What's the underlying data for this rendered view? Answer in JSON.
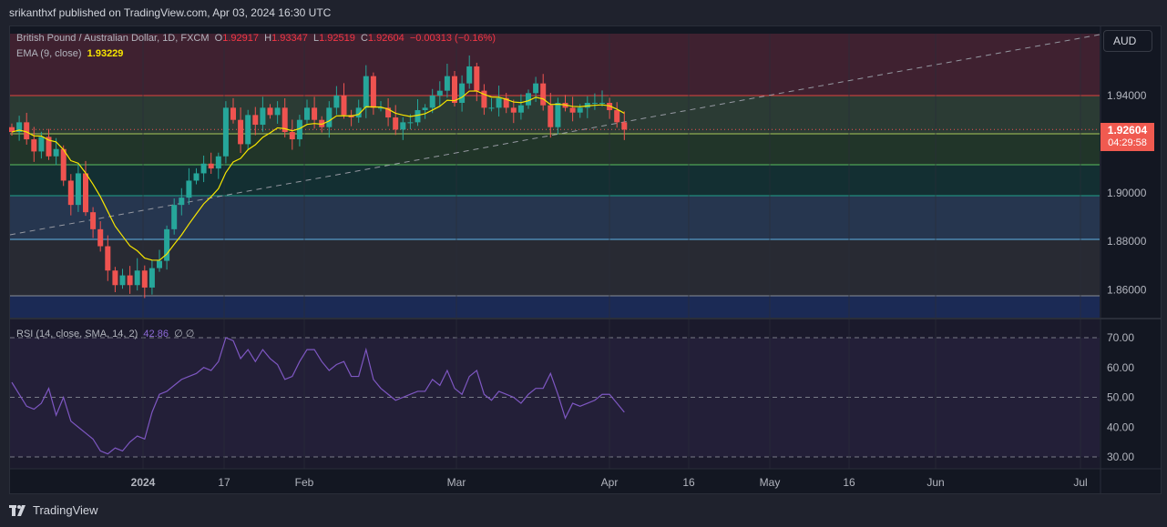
{
  "header": {
    "publisher_line": "srikanthxf published on TradingView.com, Apr 03, 2024 16:30 UTC"
  },
  "legend": {
    "symbol": "British Pound / Australian Dollar, 1D, FXCM",
    "o_label": "O",
    "o": "1.92917",
    "h_label": "H",
    "h": "1.93347",
    "l_label": "L",
    "l": "1.92519",
    "c_label": "C",
    "c": "1.92604",
    "change": "−0.00313 (−0.16%)",
    "ema_label": "EMA (9, close)",
    "ema_value": "1.93229",
    "rsi_label": "RSI (14, close, SMA, 14, 2)",
    "rsi_value": "42.86",
    "rsi_extra": "∅ ∅"
  },
  "price_axis": {
    "currency": "AUD",
    "last_price": "1.92604",
    "countdown": "04:29:58",
    "ticks": [
      "1.94000",
      "1.90000",
      "1.88000",
      "1.86000"
    ]
  },
  "rsi_axis": {
    "ticks": [
      "70.00",
      "60.00",
      "50.00",
      "40.00",
      "30.00"
    ]
  },
  "time_axis": {
    "labels": [
      "2024",
      "17",
      "Feb",
      "Mar",
      "Apr",
      "16",
      "May",
      "16",
      "Jun",
      "Jul"
    ]
  },
  "footer": {
    "brand": "TradingView"
  },
  "colors": {
    "up": "#26a69a",
    "down": "#ef5350",
    "ema": "#f7e600",
    "rsi": "#7e57c2"
  },
  "chart_data": {
    "type": "candlestick",
    "symbol": "GBPAUD",
    "timeframe": "1D",
    "ylim": [
      1.85,
      1.965
    ],
    "closes": [
      1.925,
      1.929,
      1.922,
      1.917,
      1.923,
      1.915,
      1.918,
      1.905,
      1.895,
      1.908,
      1.892,
      1.885,
      1.878,
      1.868,
      1.862,
      1.866,
      1.862,
      1.868,
      1.861,
      1.869,
      1.872,
      1.885,
      1.895,
      1.898,
      1.905,
      1.908,
      1.912,
      1.91,
      1.915,
      1.935,
      1.93,
      1.92,
      1.932,
      1.928,
      1.935,
      1.932,
      1.935,
      1.925,
      1.922,
      1.93,
      1.935,
      1.93,
      1.927,
      1.935,
      1.94,
      1.932,
      1.931,
      1.935,
      1.948,
      1.935,
      1.935,
      1.931,
      1.926,
      1.929,
      1.929,
      1.934,
      1.935,
      1.94,
      1.942,
      1.948,
      1.937,
      1.945,
      1.952,
      1.942,
      1.935,
      1.935,
      1.939,
      1.935,
      1.933,
      1.936,
      1.941,
      1.945,
      1.936,
      1.927,
      1.937,
      1.935,
      1.933,
      1.935,
      1.937,
      1.937,
      1.937,
      1.934,
      1.929,
      1.926
    ],
    "levels": [
      1.94,
      1.9275,
      1.915,
      1.9025,
      1.8845,
      1.8615
    ],
    "rsi": {
      "ylim": [
        25,
        75
      ],
      "levels": [
        70,
        50,
        30
      ],
      "values": [
        55,
        51,
        47,
        46,
        48,
        53,
        44,
        50,
        42,
        40,
        38,
        36,
        32,
        31,
        33,
        32,
        35,
        37,
        36,
        45,
        51,
        52,
        54,
        56,
        57,
        58,
        60,
        59,
        62,
        70,
        69,
        63,
        66,
        62,
        66,
        63,
        61,
        56,
        57,
        62,
        66,
        66,
        62,
        59,
        61,
        62,
        57,
        57,
        66,
        56,
        53,
        51,
        49,
        50,
        51,
        52,
        52,
        56,
        54,
        59,
        53,
        51,
        57,
        59,
        51,
        49,
        52,
        51,
        50,
        48,
        51,
        53,
        53,
        58,
        51,
        43,
        48,
        47,
        48,
        49,
        51,
        51,
        48,
        45
      ]
    }
  }
}
